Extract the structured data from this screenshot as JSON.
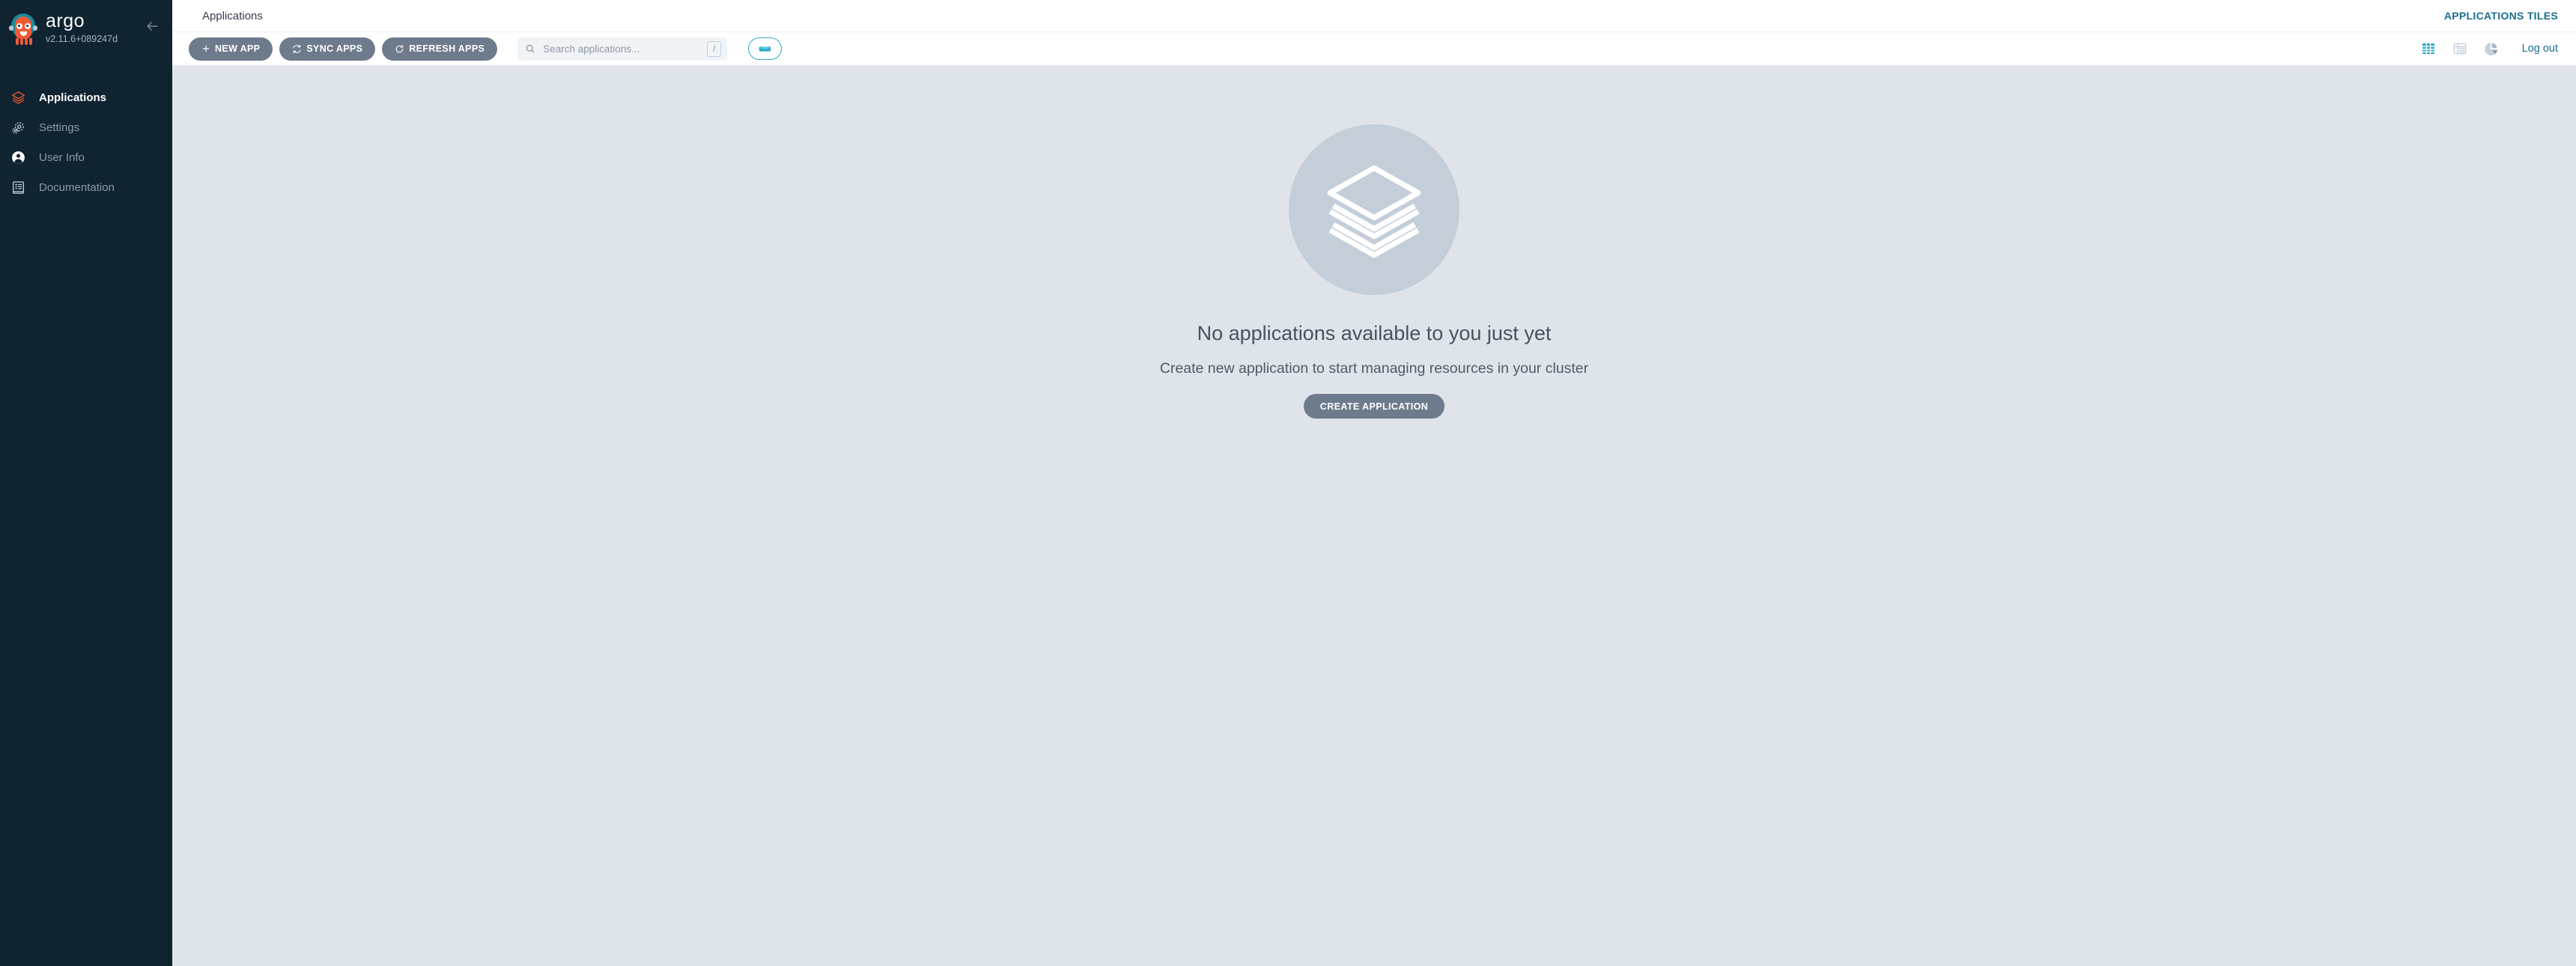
{
  "sidebar": {
    "logo": {
      "word": "argo",
      "version": "v2.11.6+089247d",
      "mascot_icon": "argo-octopus-mascot-icon"
    },
    "collapse_icon": "arrow-left-icon",
    "items": [
      {
        "label": "Applications",
        "icon": "layers-icon",
        "active": true
      },
      {
        "label": "Settings",
        "icon": "gears-icon",
        "active": false
      },
      {
        "label": "User Info",
        "icon": "user-circle-icon",
        "active": false
      },
      {
        "label": "Documentation",
        "icon": "document-list-icon",
        "active": false
      }
    ]
  },
  "header": {
    "breadcrumb": "Applications",
    "right_link": "APPLICATIONS TILES"
  },
  "toolbar": {
    "new_app_label": "NEW APP",
    "sync_apps_label": "SYNC APPS",
    "refresh_apps_label": "REFRESH APPS",
    "search": {
      "placeholder": "Search applications...",
      "value": "",
      "shortcut_key": "/",
      "icon": "search-icon"
    },
    "filter_pill_icon": "sliders-filter-icon",
    "view_modes": [
      {
        "name": "tiles",
        "icon": "grid-tiles-icon",
        "active": true
      },
      {
        "name": "list",
        "icon": "list-rows-icon",
        "active": false
      },
      {
        "name": "summary",
        "icon": "pie-chart-icon",
        "active": false
      }
    ],
    "logout_label": "Log out"
  },
  "empty_state": {
    "illustration_icon": "stacked-layers-icon",
    "title": "No applications available to you just yet",
    "subtitle": "Create new application to start managing resources in your cluster",
    "create_button_label": "CREATE APPLICATION"
  },
  "colors": {
    "sidebar_bg": "#0f2331",
    "page_bg": "#dee4ea",
    "accent_teal": "#2aacc8",
    "link_blue": "#1a6e8e",
    "button_slate": "#6d7b8d",
    "argo_orange": "#ef5b35",
    "illustration_circle": "#c3ced9"
  }
}
